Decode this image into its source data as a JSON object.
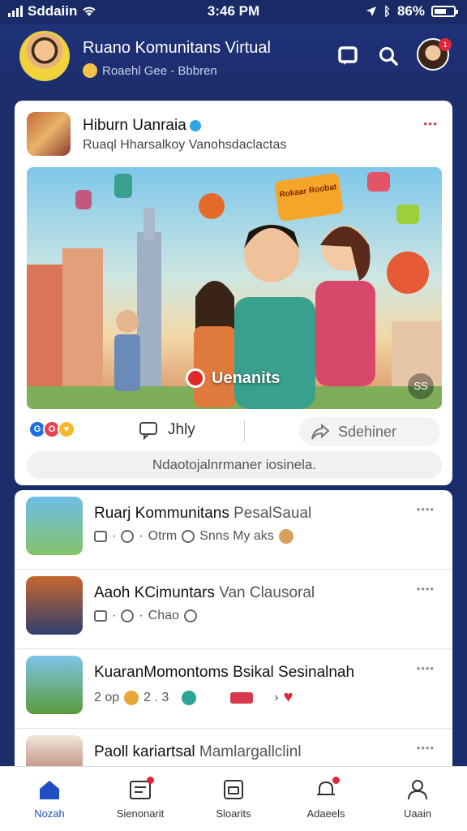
{
  "status_bar": {
    "carrier": "Sddaiin",
    "time": "3:46 PM",
    "battery": "86%"
  },
  "header": {
    "title": "Ruano Komunitans Virtual",
    "subtitle": "Roaehl Gee - Bbbren"
  },
  "post": {
    "author": "Hiburn Uanraia",
    "subtitle": "Ruaql Hharsalkoy Vanohsdaclactas",
    "image_caption": "Uenanits",
    "image_badge": "Rokaar Roobat",
    "corner_label": "SS",
    "like_label": "Jhly",
    "share_label": "Sdehiner",
    "comment_placeholder": "Ndaotojalnrmaner iosinela."
  },
  "feed": {
    "items": [
      {
        "title": "Ruarj Kommunitans",
        "title_extra": "PesalSaual",
        "meta": "Otrm",
        "meta2": "Snns My aks"
      },
      {
        "title": "Aaoh KCimuntars",
        "title_extra": "Van Clausoral",
        "meta": "Chao",
        "meta2": ""
      },
      {
        "title": "KuaranMomontoms",
        "title_extra": "Bsikal Sesinalnah",
        "meta": "2 op",
        "meta2": "2 . 3"
      },
      {
        "title": "Paoll kariartsal",
        "title_extra": "Mamlargallclinl",
        "meta": "",
        "meta2": ""
      }
    ]
  },
  "nav": {
    "home": "Nozah",
    "community": "Sienonarit",
    "shorts": "Sloarits",
    "alerts": "Adaeels",
    "profile": "Uaain"
  },
  "colors": {
    "header_bg": "#1c2d6b",
    "accent": "#1f4fc1",
    "notification": "#e0263a"
  }
}
